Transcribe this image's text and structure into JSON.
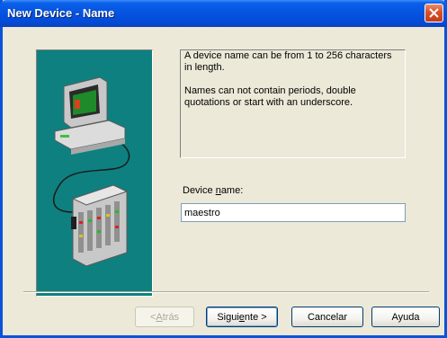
{
  "window": {
    "title": "New Device - Name"
  },
  "info": {
    "line1": "A device name can be from 1 to 256 characters in length.",
    "line2": "Names can not contain periods, double quotations or start with an underscore."
  },
  "field": {
    "label_pre": "Device ",
    "label_accel": "n",
    "label_post": "ame:",
    "value": "maestro"
  },
  "buttons": {
    "back_accel": "A",
    "back_rest": "trás",
    "back_prefix": "< ",
    "next_pre": "Sigui",
    "next_accel": "e",
    "next_post": "nte >",
    "cancel": "Cancelar",
    "help": "Ayuda"
  },
  "icons": {
    "close": "close-icon",
    "illustration": [
      "computer-icon",
      "plc-device-icon"
    ]
  },
  "colors": {
    "title_bar": "#0553e0",
    "dialog_bg": "#ece9d8",
    "illustration_bg": "#0e8080"
  }
}
